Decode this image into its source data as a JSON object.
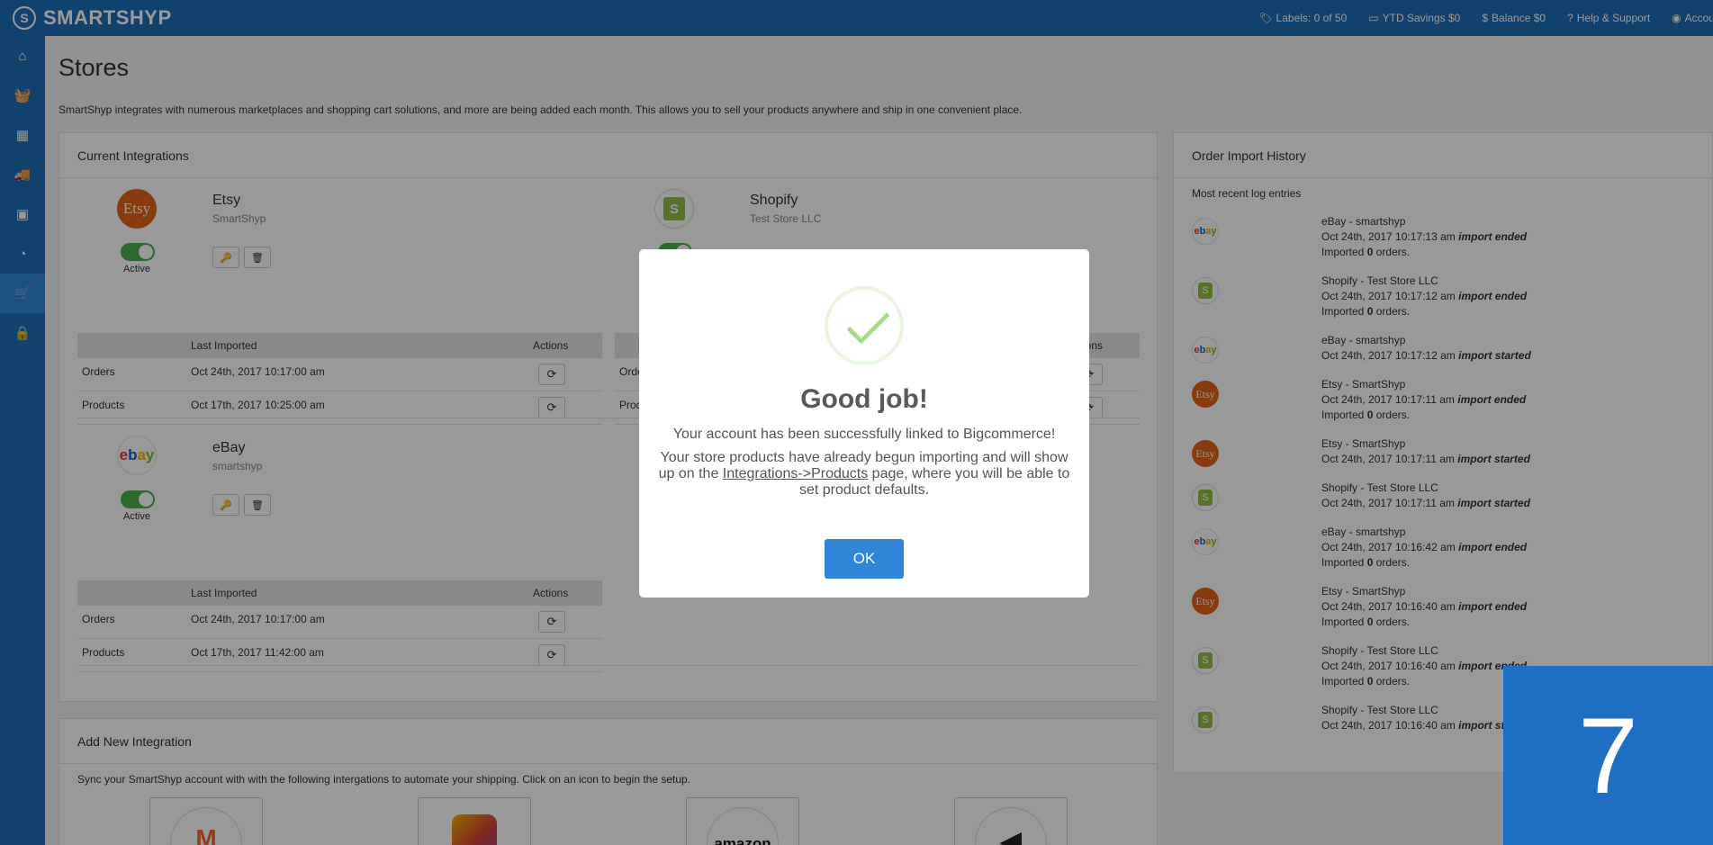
{
  "brand": {
    "name": "SMARTSHYP"
  },
  "topbar": {
    "labels": "Labels: 0 of 50",
    "ytd_savings": "YTD Savings $0",
    "balance": "Balance $0",
    "help": "Help & Support",
    "account": "Account"
  },
  "sidebar": {
    "items": [
      {
        "icon": "home-icon",
        "glyph": "⌂"
      },
      {
        "icon": "basket-icon",
        "glyph": "🧺"
      },
      {
        "icon": "calendar-icon",
        "glyph": "▦"
      },
      {
        "icon": "truck-icon",
        "glyph": "🚚"
      },
      {
        "icon": "address-book-icon",
        "glyph": "▣"
      },
      {
        "icon": "pie-chart-icon",
        "glyph": "◔"
      },
      {
        "icon": "cart-icon",
        "glyph": "🛒"
      },
      {
        "icon": "lock-icon",
        "glyph": "🔒"
      }
    ],
    "active_index": 6
  },
  "page": {
    "title": "Stores",
    "intro": "SmartShyp integrates with numerous marketplaces and shopping cart solutions, and more are being added each month. This allows you to sell your products anywhere and ship in one convenient place."
  },
  "current_integrations": {
    "title": "Current Integrations",
    "table_headers": {
      "last_imported": "Last Imported",
      "actions": "Actions"
    },
    "stores": [
      {
        "name": "Etsy",
        "account": "SmartShyp",
        "status": "Active",
        "logo_text": "Etsy",
        "rows": [
          {
            "label": "Orders",
            "last_imported": "Oct 24th, 2017 10:17:00 am"
          },
          {
            "label": "Products",
            "last_imported": "Oct 17th, 2017 10:25:00 am"
          }
        ]
      },
      {
        "name": "Shopify",
        "account": "Test Store LLC",
        "header_fragment": "ions",
        "rows": [
          {
            "label": "Orde"
          },
          {
            "label": "Prod"
          }
        ]
      },
      {
        "name": "eBay",
        "account": "smartshyp",
        "status": "Active",
        "rows": [
          {
            "label": "Orders",
            "last_imported": "Oct 24th, 2017 10:17:00 am"
          },
          {
            "label": "Products",
            "last_imported": "Oct 17th, 2017 11:42:00 am"
          }
        ]
      }
    ]
  },
  "order_history": {
    "title": "Order Import History",
    "subtitle": "Most recent log entries",
    "entries": [
      {
        "logo": "ebay",
        "store": "eBay - smartshyp",
        "time": "Oct 24th, 2017 10:17:13 am",
        "event": "import ended",
        "imported": "0"
      },
      {
        "logo": "shopify",
        "store": "Shopify - Test Store LLC",
        "time": "Oct 24th, 2017 10:17:12 am",
        "event": "import ended",
        "imported": "0"
      },
      {
        "logo": "ebay",
        "store": "eBay - smartshyp",
        "time": "Oct 24th, 2017 10:17:12 am",
        "event": "import started"
      },
      {
        "logo": "etsy",
        "store": "Etsy - SmartShyp",
        "time": "Oct 24th, 2017 10:17:11 am",
        "event": "import ended",
        "imported": "0"
      },
      {
        "logo": "etsy",
        "store": "Etsy - SmartShyp",
        "time": "Oct 24th, 2017 10:17:11 am",
        "event": "import started"
      },
      {
        "logo": "shopify",
        "store": "Shopify - Test Store LLC",
        "time": "Oct 24th, 2017 10:17:11 am",
        "event": "import started"
      },
      {
        "logo": "ebay",
        "store": "eBay - smartshyp",
        "time": "Oct 24th, 2017 10:16:42 am",
        "event": "import ended",
        "imported": "0"
      },
      {
        "logo": "etsy",
        "store": "Etsy - SmartShyp",
        "time": "Oct 24th, 2017 10:16:40 am",
        "event": "import ended",
        "imported": "0"
      },
      {
        "logo": "shopify",
        "store": "Shopify - Test Store LLC",
        "time": "Oct 24th, 2017 10:16:40 am",
        "event": "import ended",
        "imported": "0"
      },
      {
        "logo": "shopify",
        "store": "Shopify - Test Store LLC",
        "time": "Oct 24th, 2017 10:16:40 am",
        "event": "import started"
      }
    ],
    "imported_prefix": "Imported",
    "imported_suffix": "orders."
  },
  "add_integration": {
    "title": "Add New Integration",
    "subtitle": "Sync your SmartShyp account with with the following intergations to automate your shipping. Click on an icon to begin the setup.",
    "tiles": [
      {
        "icon": "magento-icon",
        "text": "M",
        "color": "#ee672f"
      },
      {
        "icon": "multicolor-logo-icon",
        "text": "",
        "color": "#f4b400"
      },
      {
        "icon": "amazon-icon",
        "text": "amazon",
        "color": "#111111"
      },
      {
        "icon": "megaphone-icon",
        "text": "◀",
        "color": "#222222"
      }
    ]
  },
  "dialog": {
    "title": "Good job!",
    "line1": "Your account has been successfully linked to Bigcommerce!",
    "line2_a": "Your store products have already begun importing and will show up on the",
    "link": "Integrations->Products",
    "line2_b": "page, where you will be able to set product defaults.",
    "ok": "OK"
  },
  "badge": {
    "number": "7"
  },
  "colors": {
    "primary": "#1d6fb8",
    "ok_button": "#3085d6",
    "success": "#a5dc86",
    "toggle_on": "#4cae4c"
  }
}
